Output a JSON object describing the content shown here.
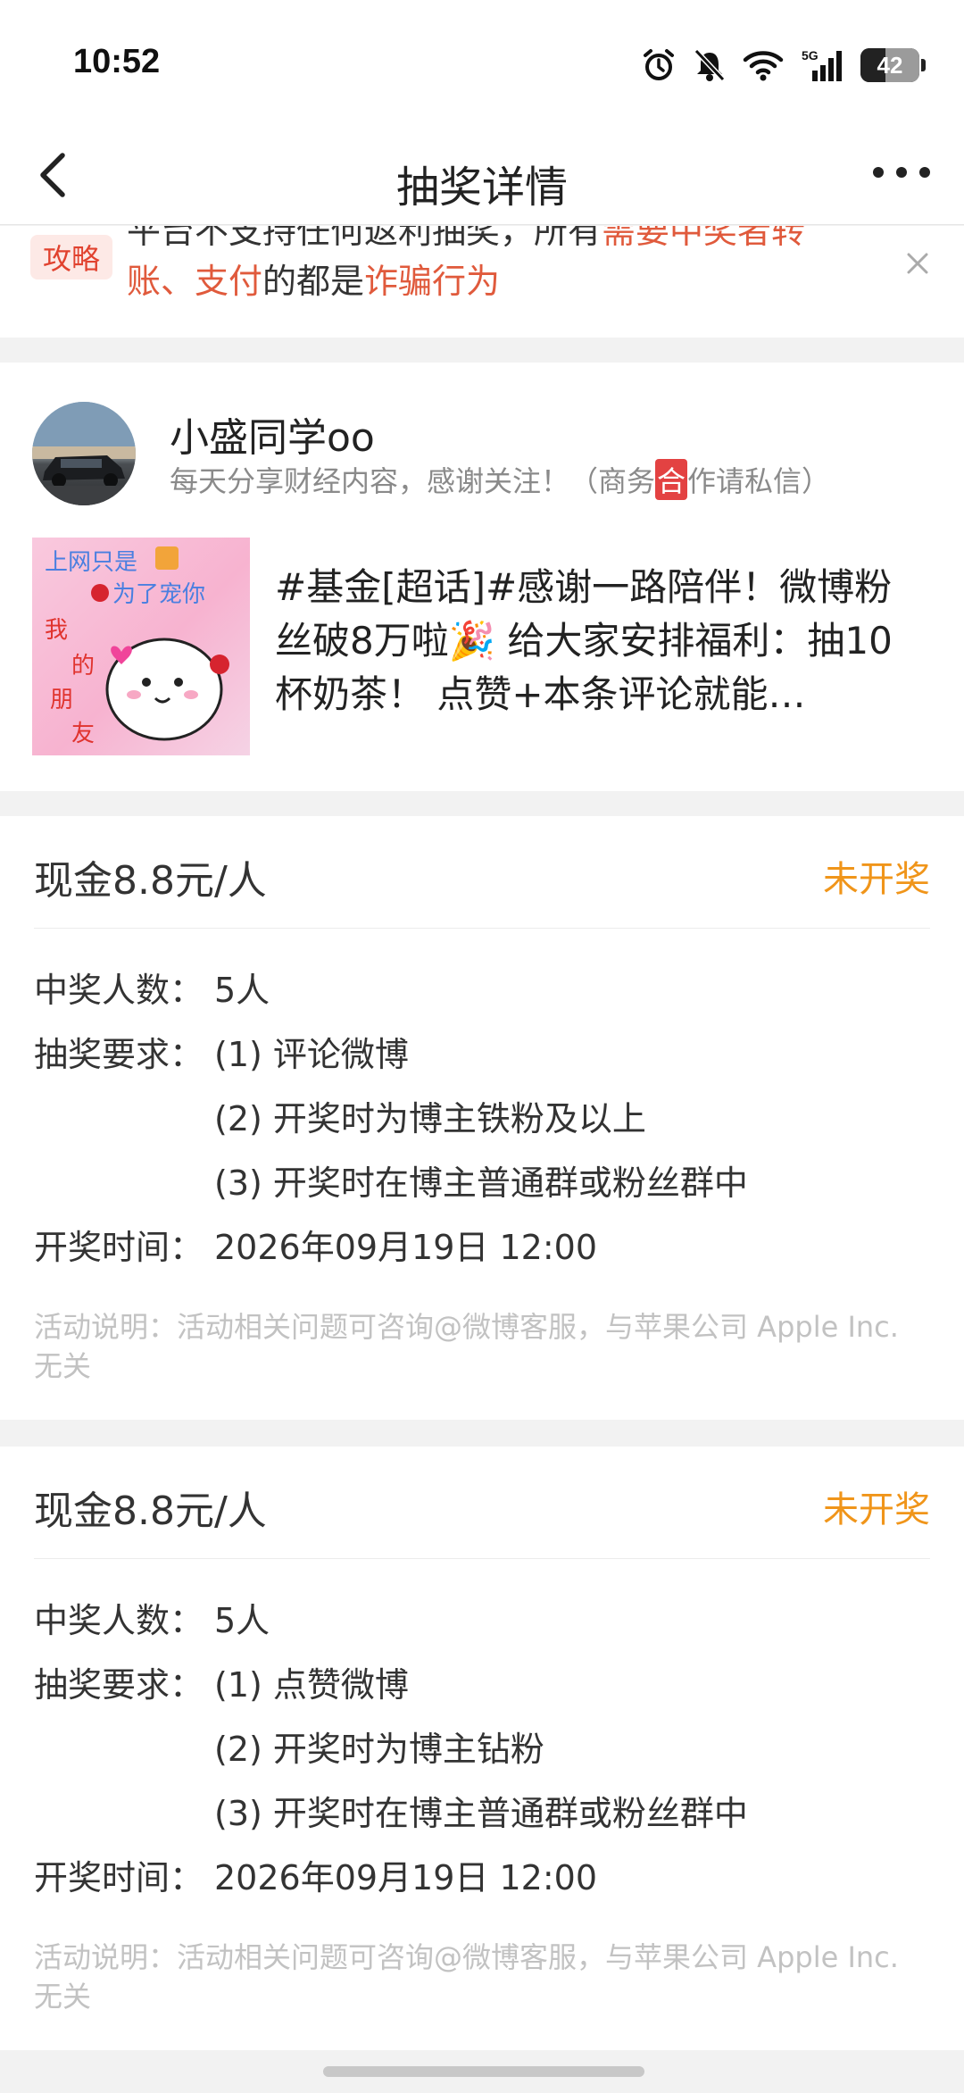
{
  "status_bar": {
    "time": "10:52",
    "network": "5G",
    "battery_level": "42",
    "battery_fraction": 0.42
  },
  "nav": {
    "title": "抽奖详情"
  },
  "notice": {
    "tag": "攻略",
    "text_part1": "平台不支持任何返利抽奖，所有",
    "text_red1": "需要中奖者转账、支付",
    "text_part2": "的都是",
    "text_red2": "诈骗行为"
  },
  "author": {
    "name": "小盛同学oo",
    "bio_part1": "每天分享财经内容，感谢关注！（商务",
    "bio_he": "合",
    "bio_part2": "作请私信）"
  },
  "post": {
    "text": "#基金[超话]#感谢一路陪伴！微博粉丝破8万啦🎉 给大家安排福利：抽10杯奶茶！ 点赞+本条评论就能…",
    "thumb_texts": [
      "上网只是",
      "为了宠你",
      "我",
      "的",
      "朋",
      "友"
    ]
  },
  "prizes": [
    {
      "title": "现金8.8元/人",
      "status": "未开奖",
      "winners_label": "中奖人数：",
      "winners_value": "5人",
      "req_label": "抽奖要求：",
      "requirements": [
        "(1) 评论微博",
        "(2) 开奖时为博主铁粉及以上",
        "(3) 开奖时在博主普通群或粉丝群中"
      ],
      "time_label": "开奖时间：",
      "time_value": "2026年09月19日 12:00",
      "note": "活动说明：活动相关问题可咨询@微博客服，与苹果公司 Apple Inc. 无关"
    },
    {
      "title": "现金8.8元/人",
      "status": "未开奖",
      "winners_label": "中奖人数：",
      "winners_value": "5人",
      "req_label": "抽奖要求：",
      "requirements": [
        "(1) 点赞微博",
        "(2) 开奖时为博主钻粉",
        "(3) 开奖时在博主普通群或粉丝群中"
      ],
      "time_label": "开奖时间：",
      "time_value": "2026年09月19日 12:00",
      "note": "活动说明：活动相关问题可咨询@微博客服，与苹果公司 Apple Inc. 无关"
    }
  ],
  "colors": {
    "accent_orange": "#f0951a",
    "warning_red": "#e05a3c",
    "muted_gray": "#8a8a8a"
  }
}
